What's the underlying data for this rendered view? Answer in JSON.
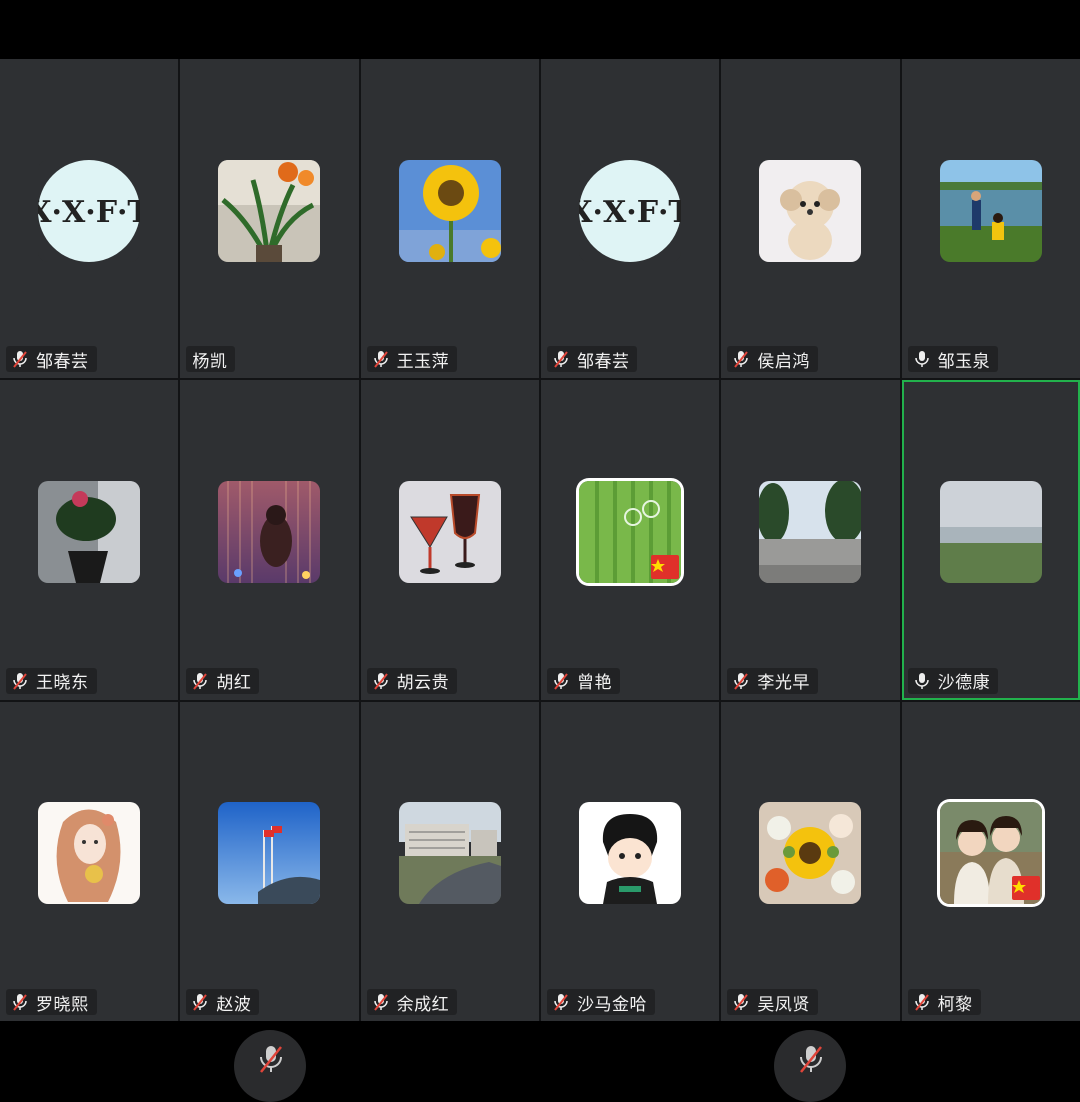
{
  "participants": [
    {
      "name": "邹春芸",
      "mic": "muted",
      "avatar": "xxft-logo"
    },
    {
      "name": "杨凯",
      "mic": "none",
      "avatar": "plant-photo"
    },
    {
      "name": "王玉萍",
      "mic": "muted",
      "avatar": "sunflower-photo"
    },
    {
      "name": "邹春芸",
      "mic": "muted",
      "avatar": "xxft-logo"
    },
    {
      "name": "侯启鸿",
      "mic": "muted",
      "avatar": "puppy-photo"
    },
    {
      "name": "邹玉泉",
      "mic": "on",
      "avatar": "lake-fishing-photo"
    },
    {
      "name": "王晓东",
      "mic": "muted",
      "avatar": "potted-plant-photo"
    },
    {
      "name": "胡红",
      "mic": "muted",
      "avatar": "light-curtain-photo"
    },
    {
      "name": "胡云贵",
      "mic": "muted",
      "avatar": "wine-glasses-photo"
    },
    {
      "name": "曾艳",
      "mic": "muted",
      "avatar": "green-bamboo-photo",
      "flag": true
    },
    {
      "name": "李光早",
      "mic": "muted",
      "avatar": "road-trees-photo"
    },
    {
      "name": "沙德康",
      "mic": "on",
      "avatar": "lake-shore-photo",
      "active": true
    },
    {
      "name": "罗晓熙",
      "mic": "muted",
      "avatar": "girl-drawing"
    },
    {
      "name": "赵波",
      "mic": "muted",
      "avatar": "flags-building-photo"
    },
    {
      "name": "余成红",
      "mic": "muted",
      "avatar": "campus-road-photo"
    },
    {
      "name": "沙马金哈",
      "mic": "muted",
      "avatar": "cartoon-character"
    },
    {
      "name": "吴凤贤",
      "mic": "muted",
      "avatar": "flower-bouquet-photo"
    },
    {
      "name": "柯黎",
      "mic": "muted",
      "avatar": "two-girls-photo",
      "flag": true
    }
  ],
  "colors": {
    "tile": "#2e3033",
    "active_border": "#22b14c",
    "mute_slash": "#e0453a"
  },
  "toolbar": [
    {
      "icon": "mic-muted-icon"
    },
    {
      "icon": "mic-muted-icon"
    }
  ]
}
